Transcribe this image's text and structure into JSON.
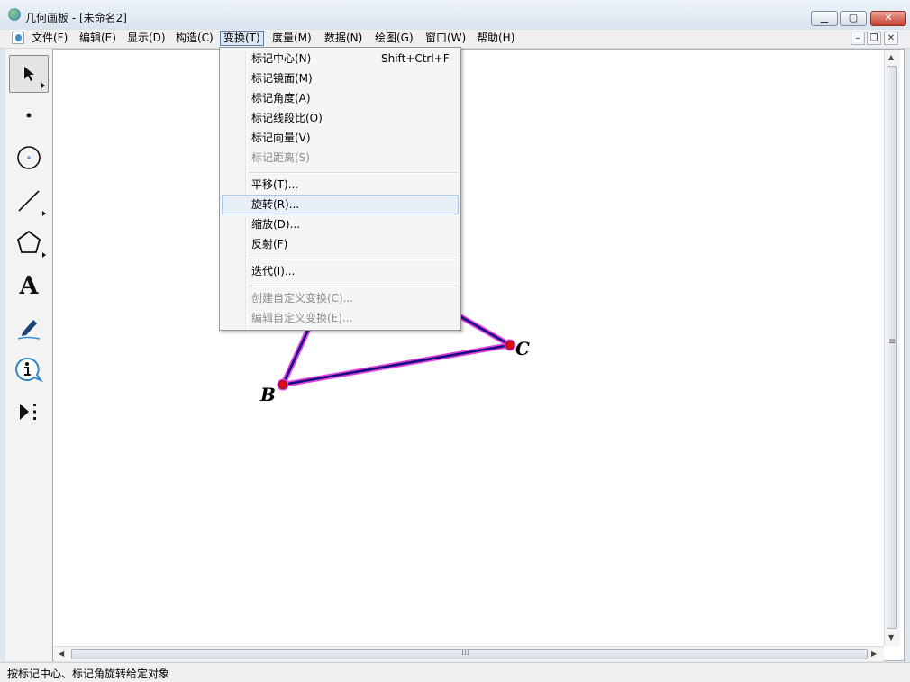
{
  "window": {
    "title": "几何画板 - [未命名2]",
    "min": "▁",
    "max": "▢",
    "close": "✕"
  },
  "menubar": {
    "items": [
      "文件(F)",
      "编辑(E)",
      "显示(D)",
      "构造(C)",
      "变换(T)",
      "度量(M)",
      "数据(N)",
      "绘图(G)",
      "窗口(W)",
      "帮助(H)"
    ],
    "doc_min": "–",
    "doc_restore": "❐",
    "doc_close": "✕"
  },
  "transform_menu": {
    "items": [
      {
        "label": "标记中心(N)",
        "shortcut": "Shift+Ctrl+F",
        "enabled": true
      },
      {
        "label": "标记镜面(M)",
        "enabled": true
      },
      {
        "label": "标记角度(A)",
        "enabled": true
      },
      {
        "label": "标记线段比(O)",
        "enabled": true
      },
      {
        "label": "标记向量(V)",
        "enabled": true
      },
      {
        "label": "标记距离(S)",
        "enabled": false
      },
      {
        "label": "平移(T)...",
        "enabled": true
      },
      {
        "label": "旋转(R)...",
        "enabled": true,
        "highlighted": true
      },
      {
        "label": "缩放(D)...",
        "enabled": true
      },
      {
        "label": "反射(F)",
        "enabled": true
      },
      {
        "label": "迭代(I)...",
        "enabled": true
      },
      {
        "label": "创建自定义变换(C)...",
        "enabled": false
      },
      {
        "label": "编辑自定义变换(E)...",
        "enabled": false
      }
    ]
  },
  "toolbox": {
    "tools": [
      {
        "name": "arrow-tool-icon",
        "selected": true
      },
      {
        "name": "point-tool-icon"
      },
      {
        "name": "compass-tool-icon"
      },
      {
        "name": "straightedge-tool-icon"
      },
      {
        "name": "polygon-tool-icon"
      },
      {
        "name": "text-tool-icon",
        "glyph": "A"
      },
      {
        "name": "marker-tool-icon"
      },
      {
        "name": "information-tool-icon"
      },
      {
        "name": "custom-tool-icon"
      }
    ]
  },
  "canvas": {
    "points": {
      "b": "B",
      "c": "C"
    },
    "colors": {
      "segment": "#10107a",
      "highlight": "#e040e0",
      "point": "#e01010"
    }
  },
  "status": {
    "text": "按标记中心、标记角旋转给定对象"
  },
  "scroll": {
    "h_grip": "⁞⁞⁞",
    "v_grip": "≡"
  }
}
